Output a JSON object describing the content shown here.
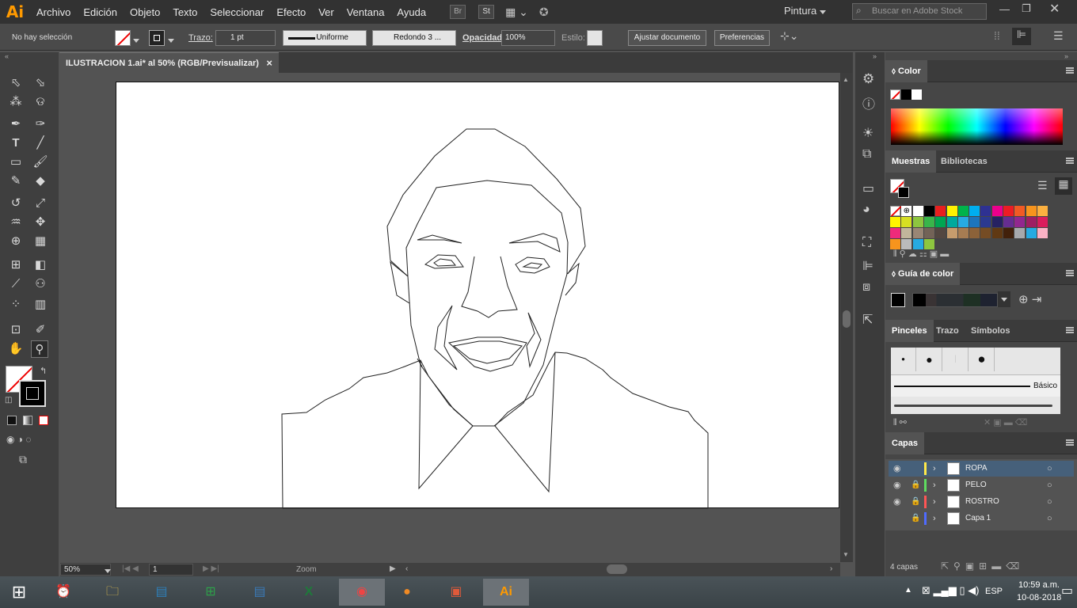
{
  "app": {
    "logo": "Ai",
    "menu": [
      "Archivo",
      "Edición",
      "Objeto",
      "Texto",
      "Seleccionar",
      "Efecto",
      "Ver",
      "Ventana",
      "Ayuda"
    ],
    "btn_br": "Br",
    "btn_st": "St",
    "workspace": "Pintura",
    "search_placeholder": "Buscar en Adobe Stock"
  },
  "control": {
    "selection": "No hay selección",
    "stroke_label": "Trazo:",
    "stroke_value": "1 pt",
    "stroke_style": "Uniforme",
    "brush": "Redondo 3 ...",
    "opacity_label": "Opacidad:",
    "opacity_value": "100%",
    "style_label": "Estilo:",
    "btn_adjust": "Ajustar documento",
    "btn_prefs": "Preferencias"
  },
  "document": {
    "tab_title": "ILUSTRACION 1.ai* al 50% (RGB/Previsualizar)",
    "close": "×"
  },
  "status": {
    "zoom": "50%",
    "page": "1",
    "label": "Zoom"
  },
  "panels": {
    "color_title": "Color",
    "swatches_tabs": [
      "Muestras",
      "Bibliotecas"
    ],
    "guide_title": "Guía de color",
    "brush_tabs": [
      "Pinceles",
      "Trazo",
      "Símbolos"
    ],
    "brush_basic": "Básico",
    "layers_title": "Capas",
    "layers": [
      {
        "name": "ROPA",
        "color": "#ffe94a",
        "visible": true,
        "locked": false
      },
      {
        "name": "PELO",
        "color": "#5fdc5f",
        "visible": true,
        "locked": true
      },
      {
        "name": "ROSTRO",
        "color": "#ff5555",
        "visible": true,
        "locked": true
      },
      {
        "name": "Capa 1",
        "color": "#4f6bff",
        "visible": false,
        "locked": true
      }
    ],
    "layers_count": "4 capas"
  },
  "taskbar": {
    "lang": "ESP",
    "time": "10:59 a.m.",
    "date": "10-08-2018"
  },
  "colors": {
    "accent": "#ff9a00",
    "selected_layer": "#46607a"
  }
}
